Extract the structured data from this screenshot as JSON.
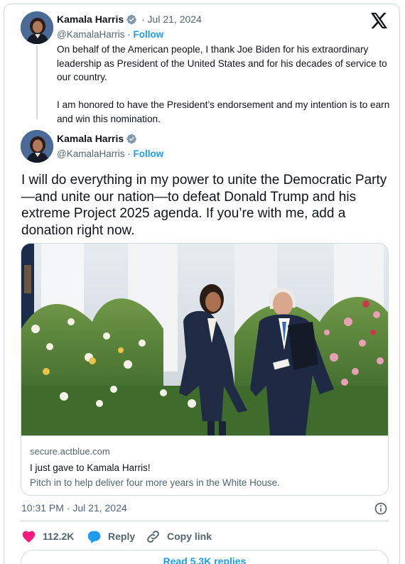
{
  "brand": {
    "logo": "x-logo-icon",
    "accent": "#1d9bf0",
    "like_color": "#f91880",
    "text_color": "#0f1419",
    "muted_color": "#536471"
  },
  "quoted_tweet": {
    "author_name": "Kamala Harris",
    "verified_badge": "verified-badge-icon",
    "date": "· Jul 21, 2024",
    "handle": "@KamalaHarris",
    "separator": "·",
    "follow_label": "Follow",
    "paragraphs": [
      "On behalf of the American people, I thank Joe Biden for his extraordinary leadership as President of the United States and for his decades of service to our country.",
      "I am honored to have the President’s endorsement and my intention is to earn and win this nomination."
    ]
  },
  "main_tweet": {
    "author_name": "Kamala Harris",
    "verified_badge": "verified-badge-icon",
    "handle": "@KamalaHarris",
    "separator": "·",
    "follow_label": "Follow",
    "text": "I will do everything in my power to unite the Democratic Party—and unite our nation—to defeat Donald Trump and his extreme Project 2025 agenda. If you’re with me, add a donation right now.",
    "link_card": {
      "domain": "secure.actblue.com",
      "title": "I just gave to Kamala Harris!",
      "description": "Pitch in to help deliver four more years in the White House."
    },
    "timestamp": "10:31 PM · Jul 21, 2024",
    "info_icon": "info-icon",
    "actions": {
      "likes": "112.2K",
      "reply_label": "Reply",
      "copy_link_label": "Copy link"
    },
    "read_replies_label": "Read 5.3K replies"
  }
}
